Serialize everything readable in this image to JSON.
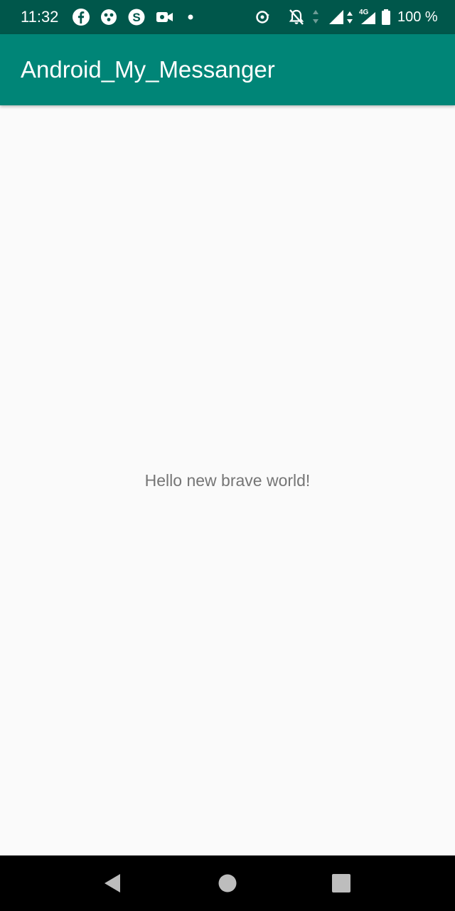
{
  "status_bar": {
    "time": "11:32",
    "battery": "100 %",
    "network_type": "4G",
    "notification_icons": [
      "facebook-icon",
      "game-controller-icon",
      "skype-icon",
      "video-camera-icon",
      "dot-icon"
    ],
    "system_icons": [
      "data-saver-icon",
      "notifications-off-icon",
      "signal-icon",
      "signal-4g-icon",
      "battery-full-icon"
    ]
  },
  "app_bar": {
    "title": "Android_My_Messanger",
    "color": "#008577"
  },
  "main": {
    "message": "Hello new brave world!"
  },
  "nav_bar": {
    "buttons": [
      "back-icon",
      "home-icon",
      "recents-icon"
    ]
  },
  "colors": {
    "status_bar": "#00574B",
    "app_bar": "#008577",
    "background": "#FAFAFA",
    "text": "#757575"
  }
}
